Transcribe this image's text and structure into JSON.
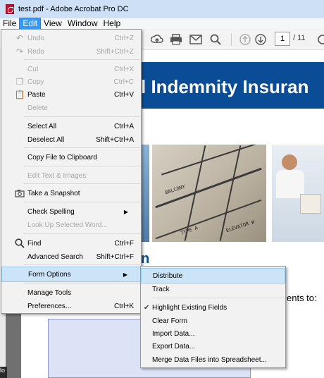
{
  "window": {
    "title": "test.pdf - Adobe Acrobat Pro DC"
  },
  "menubar": [
    "File",
    "Edit",
    "View",
    "Window",
    "Help"
  ],
  "toolbar": {
    "page_current": "1",
    "page_total": "/ 11"
  },
  "document": {
    "banner_text": "l Indemnity Insuran",
    "section_heading": "n",
    "body_text": "ents to:",
    "photo_text": {
      "balcony": "BALCONY",
      "type_a": "TYPE A",
      "elevator": "ELEVATOR W"
    }
  },
  "edit_menu": {
    "items": [
      {
        "label": "Undo",
        "shortcut": "Ctrl+Z",
        "disabled": true,
        "icon": "undo-icon"
      },
      {
        "label": "Redo",
        "shortcut": "Shift+Ctrl+Z",
        "disabled": true,
        "icon": "redo-icon"
      },
      {
        "label": "Cut",
        "shortcut": "Ctrl+X",
        "disabled": true
      },
      {
        "label": "Copy",
        "shortcut": "Ctrl+C",
        "disabled": true,
        "icon": "copy-icon"
      },
      {
        "label": "Paste",
        "shortcut": "Ctrl+V",
        "disabled": false,
        "icon": "paste-icon"
      },
      {
        "label": "Delete",
        "shortcut": "",
        "disabled": true
      },
      {
        "label": "Select All",
        "shortcut": "Ctrl+A",
        "disabled": false
      },
      {
        "label": "Deselect All",
        "shortcut": "Shift+Ctrl+A",
        "disabled": false
      },
      {
        "label": "Copy File to Clipboard",
        "shortcut": "",
        "disabled": false
      },
      {
        "label": "Edit Text & Images",
        "shortcut": "",
        "disabled": true
      },
      {
        "label": "Take a Snapshot",
        "shortcut": "",
        "disabled": false,
        "icon": "camera-icon"
      },
      {
        "label": "Check Spelling",
        "shortcut": "",
        "disabled": false,
        "submenu": true
      },
      {
        "label": "Look Up Selected Word...",
        "shortcut": "",
        "disabled": true
      },
      {
        "label": "Find",
        "shortcut": "Ctrl+F",
        "disabled": false,
        "icon": "search-icon"
      },
      {
        "label": "Advanced Search",
        "shortcut": "Shift+Ctrl+F",
        "disabled": false
      },
      {
        "label": "Form Options",
        "shortcut": "",
        "disabled": false,
        "submenu": true,
        "highlighted": true
      },
      {
        "label": "Manage Tools",
        "shortcut": "",
        "disabled": false
      },
      {
        "label": "Preferences...",
        "shortcut": "Ctrl+K",
        "disabled": false
      }
    ]
  },
  "form_options_submenu": {
    "items": [
      {
        "label": "Distribute",
        "highlighted": true
      },
      {
        "label": "Track"
      },
      {
        "label": "Highlight Existing Fields",
        "checked": true
      },
      {
        "label": "Clear Form"
      },
      {
        "label": "Import Data..."
      },
      {
        "label": "Export Data..."
      },
      {
        "label": "Merge Data Files into Spreadsheet..."
      }
    ]
  },
  "colors": {
    "menu_active": "#3399ff",
    "hover": "#cce4f7",
    "banner": "#0a4d96"
  }
}
